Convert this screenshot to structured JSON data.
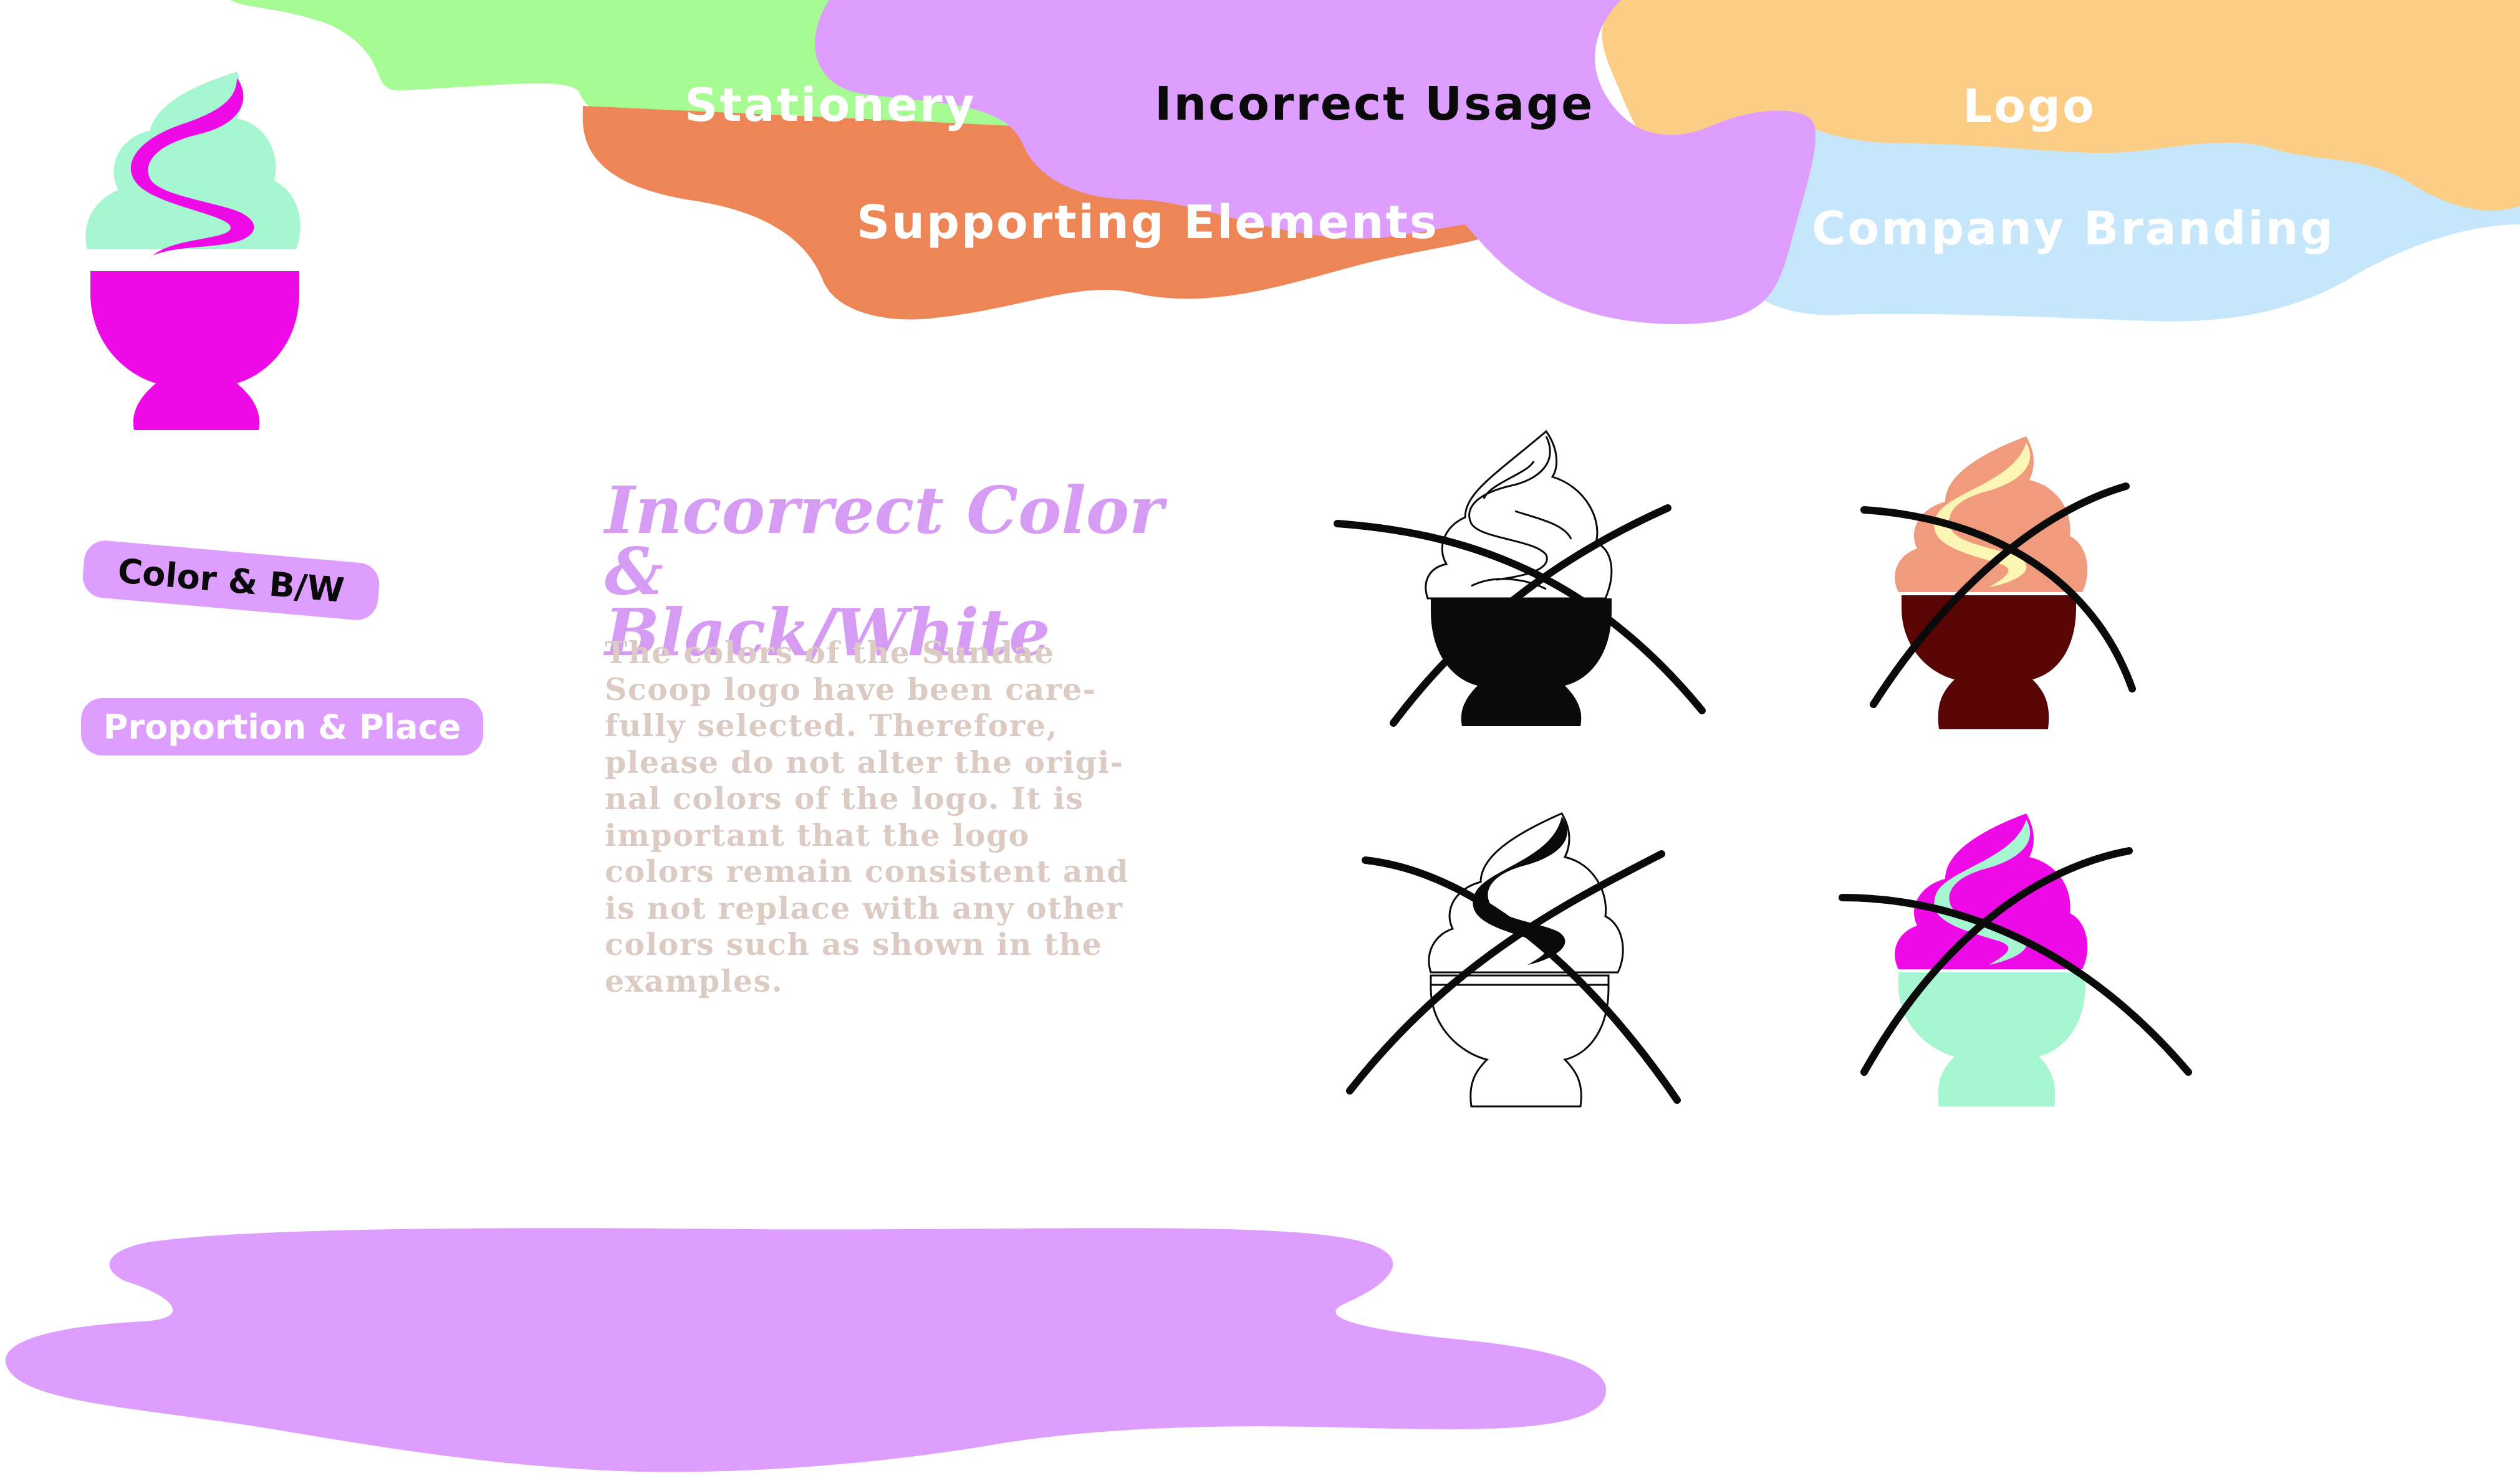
{
  "nav": {
    "stationery": "Stationery",
    "incorrect_usage": "Incorrect Usage",
    "logo": "Logo",
    "supporting_elements": "Supporting Elements",
    "company_branding": "Company Branding"
  },
  "sidebar": {
    "color_bw": "Color & B/W",
    "proportion_place": "Proportion & Place"
  },
  "section": {
    "title_line1": "Incorrect Color &",
    "title_line2": "Black/White",
    "body_lines": [
      "The colors of the Sundae",
      "Scoop logo have been care-",
      "fully selected. Therefore,",
      "please do not alter the origi-",
      "nal colors of the logo. It is",
      "important that the logo",
      "colors remain consistent and",
      "is not replace with any other",
      "colors such as shown in the",
      "examples."
    ]
  },
  "icons": {
    "brand_logo": "sundae-logo-icon",
    "examples": [
      "black-sundae-example-icon",
      "dark-red-sundae-example-icon",
      "outline-sundae-example-icon",
      "wrong-colors-sundae-example-icon"
    ],
    "cross_mark": "cross-out-icon"
  },
  "colors": {
    "green_blob": "#a6fb93",
    "orange_blob": "#ee8556",
    "purple_blob": "#dd9eff",
    "peach_blob": "#fbcd85",
    "light_blue_blob": "#c6e6fc",
    "brand_magenta": "#ee0ae6",
    "brand_mint": "#a5f6d1",
    "dark_red_bowl": "#5a0505",
    "salmon_cream": "#f19b7e",
    "pale_yellow_swirl": "#fdf5b3",
    "title_purple": "#d69bf2",
    "body_text_beige": "#dccbc3"
  }
}
